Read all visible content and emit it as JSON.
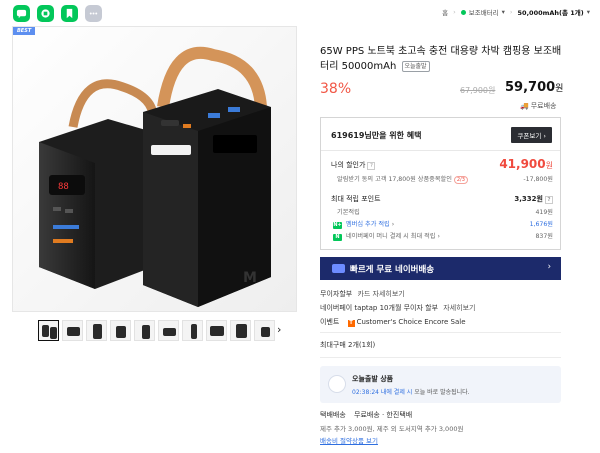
{
  "breadcrumb": {
    "home": "홈",
    "category": "보조배터리",
    "current": "50,000mAh(총 1개)"
  },
  "product": {
    "badge": "BEST",
    "title": "65W PPS 노트북 초고속 충전 대용량 차박 캠핑용 보조배터리 50000mAh",
    "today_tag": "오늘출발",
    "discount": "38%",
    "original_price": "67,900",
    "price": "59,700",
    "won": "원",
    "shipping": "무료배송"
  },
  "benefit": {
    "header": "619619님만을 위한 혜택",
    "coupon_btn": "쿠폰보기",
    "my_price_label": "나의 할인가",
    "my_price": "41,900",
    "my_price_note": "알림받기 동의 고객 17,800원 상품중복할인",
    "my_price_note_badge": "2/3",
    "my_price_sub": "-17,800원",
    "points_label": "최대 적립 포인트",
    "points": "3,332원",
    "basic_label": "기본적립",
    "basic": "419원",
    "membership_label": "멤버십 추가 적립",
    "membership": "1,676원",
    "npay_label": "네이버페이 머니 결제 시 최대 적립",
    "npay": "837원"
  },
  "fast_delivery": "빠르게 무료 네이버배송",
  "info": {
    "installment_label": "무이자할부",
    "installment_link": "카드 자세히보기",
    "taptap": "네이버페이 taptap 10개월 무이자 할부",
    "taptap_link": "자세히보기",
    "event_label": "이벤트",
    "event_text": "Customer's Choice Encore Sale",
    "max_buy": "최대구매 2개(1회)"
  },
  "today_ship": {
    "title": "오늘출발 상품",
    "time": "02:38:24 내에 결제 시",
    "rest": "오늘 바로 발송됩니다."
  },
  "delivery": {
    "label": "택배배송",
    "value": "무료배송 · 한진택배",
    "extra": "제주 추가 3,000원, 제주 외 도서지역 추가 3,000원",
    "link": "배송비 절약상품 보기"
  },
  "colors": {
    "brand_green": "#03c75a",
    "discount_red": "#f15746",
    "navy": "#1c2a6b"
  }
}
